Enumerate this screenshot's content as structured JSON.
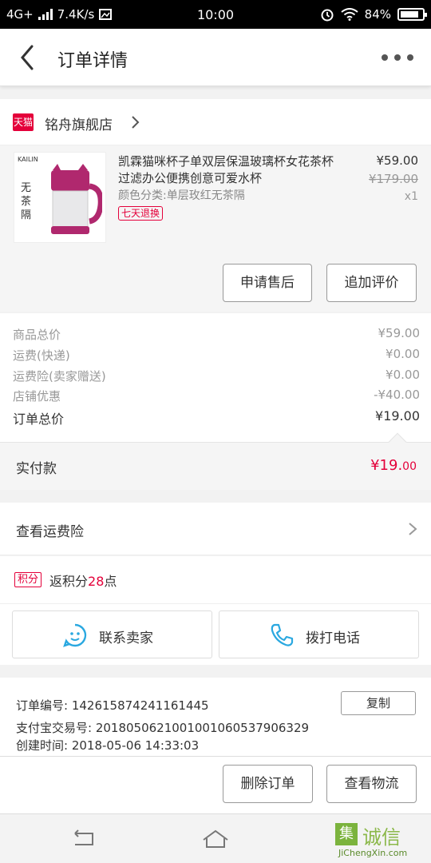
{
  "status": {
    "network": "4G+",
    "speed": "7.4K/s",
    "time": "10:00",
    "battery": "84%"
  },
  "header": {
    "title": "订单详情"
  },
  "store": {
    "badge": "天猫",
    "name": "铭舟旗舰店"
  },
  "product": {
    "brand": "KAILIN",
    "image_text": "无茶隔",
    "title": "凯霖猫咪杯子单双层保温玻璃杯女花茶杯过滤办公便携创意可爱水杯",
    "spec": "颜色分类:单层玫红无茶隔",
    "tag": "七天退换",
    "price": "¥59.00",
    "original_price": "¥179.00",
    "quantity": "x1",
    "after_sale_label": "申请售后",
    "add_review_label": "追加评价"
  },
  "summary": {
    "rows": [
      {
        "label": "商品总价",
        "value": "¥59.00"
      },
      {
        "label": "运费(快递)",
        "value": "¥0.00"
      },
      {
        "label": "运费险(卖家赠送)",
        "value": "¥0.00"
      },
      {
        "label": "店铺优惠",
        "value": "-¥40.00"
      }
    ],
    "total_label": "订单总价",
    "total_value": "¥19.00",
    "paid_label": "实付款",
    "paid_main": "¥19.",
    "paid_cents": "00"
  },
  "insurance": {
    "label": "查看运费险"
  },
  "points": {
    "badge": "积分",
    "prefix": "返积分",
    "value": "28",
    "suffix": "点"
  },
  "contact": {
    "seller_label": "联系卖家",
    "call_label": "拨打电话"
  },
  "order_info": {
    "order_no": "订单编号: 142615874241161445",
    "alipay_no": "支付宝交易号: 2018050621001001060537906329",
    "created": "创建时间: 2018-05-06 14:33:03",
    "copy_label": "复制"
  },
  "bottom": {
    "delete_label": "删除订单",
    "logistics_label": "查看物流"
  },
  "watermark": {
    "cn": "诚信",
    "en": "JiChengXin.com",
    "mark": "集"
  },
  "colors": {
    "accent": "#e4003a",
    "text": "#333333",
    "muted": "#999999"
  }
}
